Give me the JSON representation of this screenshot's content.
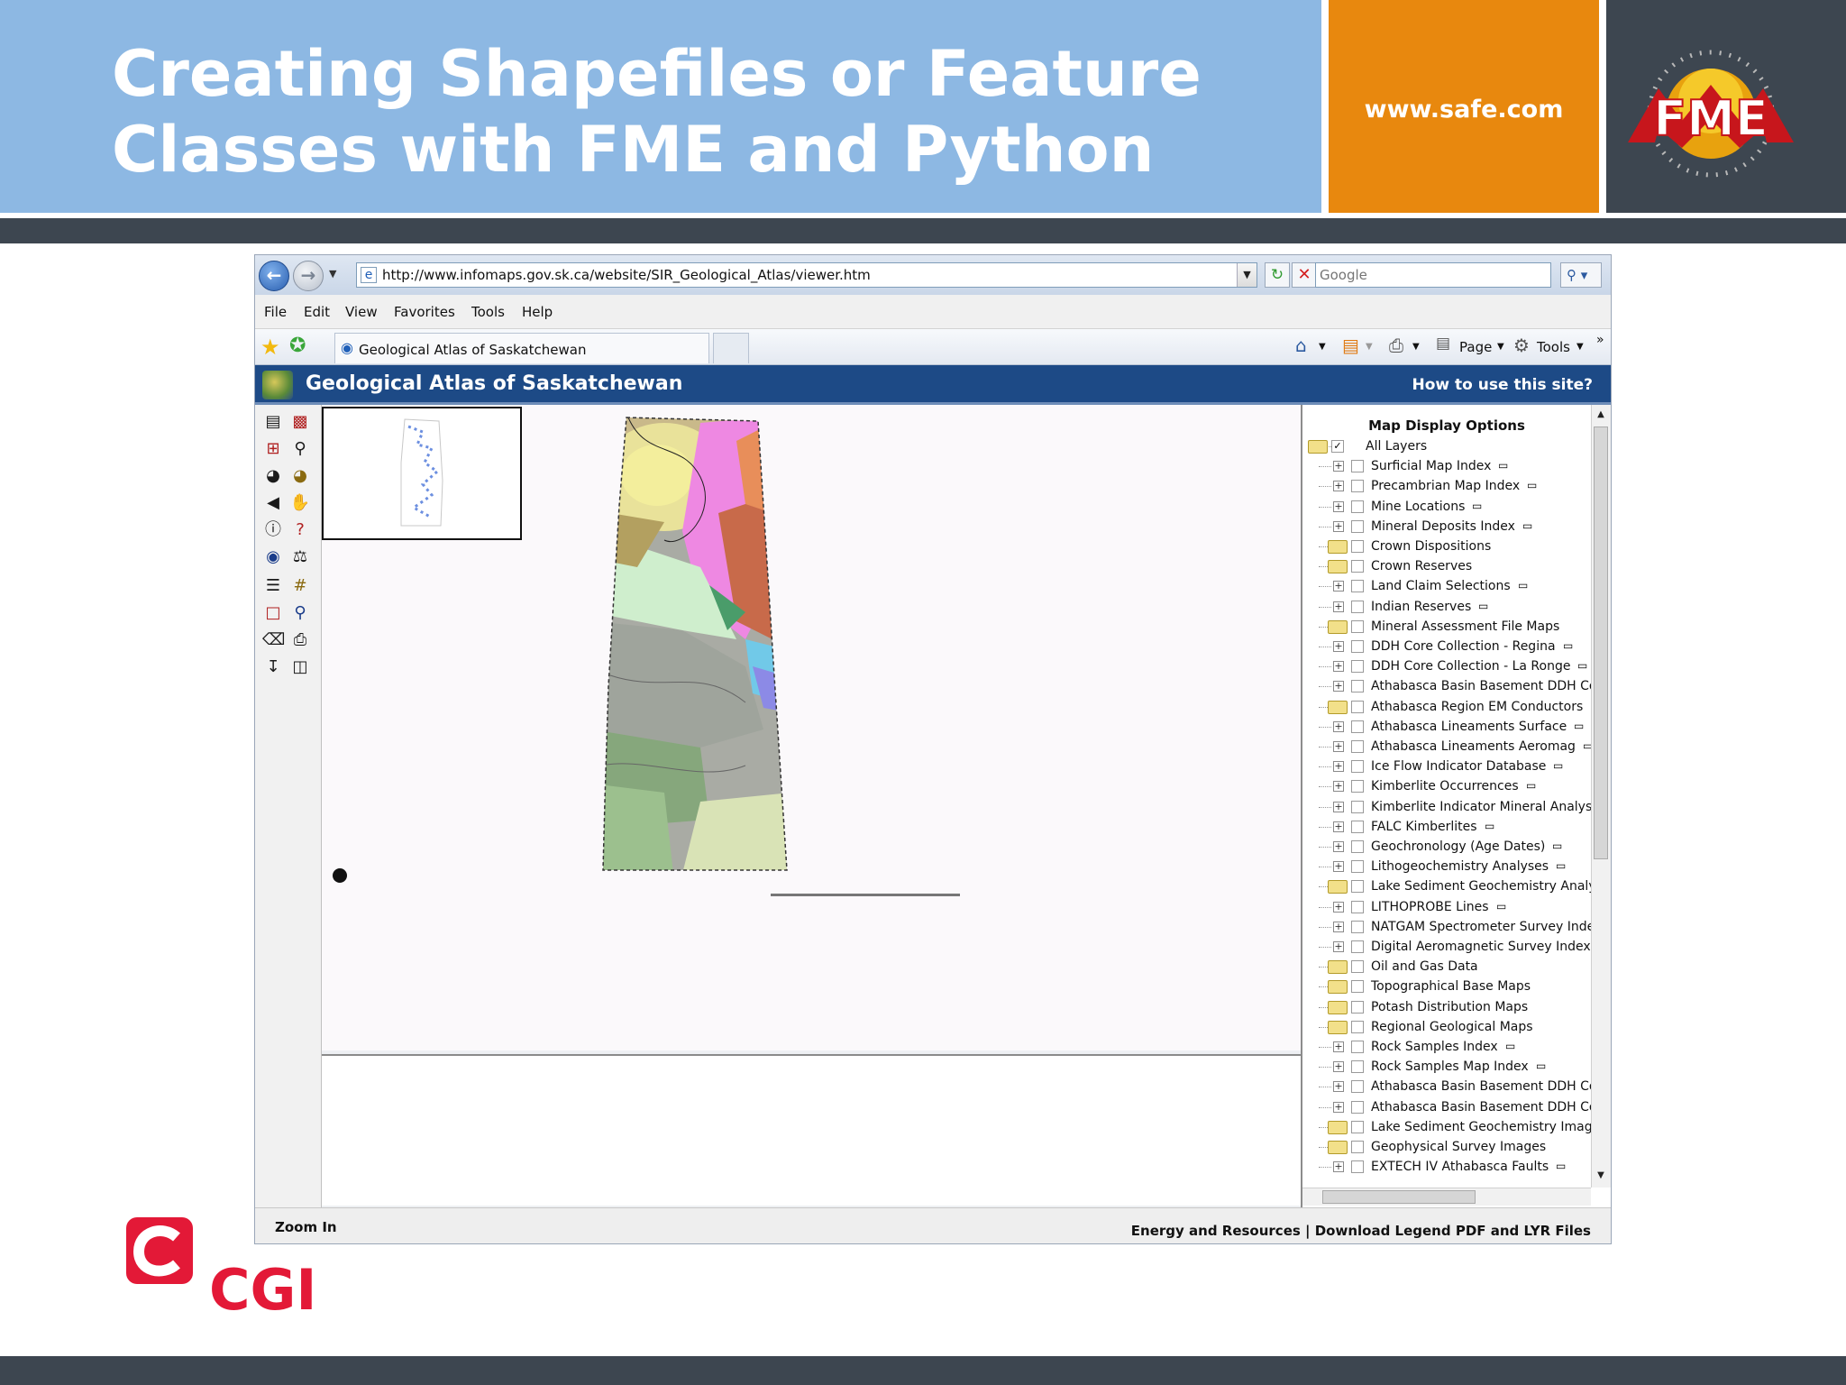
{
  "slide": {
    "title_line1": "Creating Shapefiles or Feature",
    "title_line2": "Classes with FME and Python",
    "url": "www.safe.com",
    "fme_logo": "FME",
    "cgi_logo": "CGI",
    "colors": {
      "banner_blue": "#8db8e3",
      "banner_orange": "#e8880e",
      "banner_dark": "#3d4650",
      "cgi_red": "#e31937"
    }
  },
  "browser": {
    "address": "http://www.infomaps.gov.sk.ca/website/SIR_Geological_Atlas/viewer.htm",
    "search_placeholder": "Google",
    "menu": [
      "File",
      "Edit",
      "View",
      "Favorites",
      "Tools",
      "Help"
    ],
    "tab_label": "Geological Atlas of Saskatchewan",
    "commands": {
      "page": "Page",
      "tools": "Tools"
    }
  },
  "app": {
    "title": "Geological Atlas of Saskatchewan",
    "help_link": "How to use this site?",
    "status_left": "Zoom In",
    "status_right": "Energy and Resources  |  Download Legend PDF and LYR Files"
  },
  "layers": {
    "header": "Map Display Options",
    "items": [
      {
        "label": "All Layers",
        "kind": "root",
        "checked": true
      },
      {
        "label": "Surficial Map Index",
        "kind": "layer"
      },
      {
        "label": "Precambrian Map Index",
        "kind": "layer"
      },
      {
        "label": "Mine Locations",
        "kind": "layer"
      },
      {
        "label": "Mineral Deposits Index",
        "kind": "layer"
      },
      {
        "label": "Crown Dispositions",
        "kind": "folder"
      },
      {
        "label": "Crown Reserves",
        "kind": "folder"
      },
      {
        "label": "Land Claim Selections",
        "kind": "layer"
      },
      {
        "label": "Indian Reserves",
        "kind": "layer"
      },
      {
        "label": "Mineral Assessment File Maps",
        "kind": "folder"
      },
      {
        "label": "DDH Core Collection - Regina",
        "kind": "layer"
      },
      {
        "label": "DDH Core Collection - La Ronge",
        "kind": "layer"
      },
      {
        "label": "Athabasca Basin Basement DDH Com",
        "kind": "layer"
      },
      {
        "label": "Athabasca Region EM Conductors",
        "kind": "folder"
      },
      {
        "label": "Athabasca Lineaments Surface",
        "kind": "layer"
      },
      {
        "label": "Athabasca Lineaments Aeromag",
        "kind": "layer"
      },
      {
        "label": "Ice Flow Indicator Database",
        "kind": "layer"
      },
      {
        "label": "Kimberlite Occurrences",
        "kind": "layer"
      },
      {
        "label": "Kimberlite Indicator Mineral Analyses",
        "kind": "layer"
      },
      {
        "label": "FALC Kimberlites",
        "kind": "layer"
      },
      {
        "label": "Geochronology (Age Dates)",
        "kind": "layer"
      },
      {
        "label": "Lithogeochemistry Analyses",
        "kind": "layer"
      },
      {
        "label": "Lake Sediment Geochemistry Analyse",
        "kind": "folder"
      },
      {
        "label": "LITHOPROBE Lines",
        "kind": "layer"
      },
      {
        "label": "NATGAM Spectrometer Survey Index",
        "kind": "layer"
      },
      {
        "label": "Digital Aeromagnetic Survey Index",
        "kind": "layer"
      },
      {
        "label": "Oil and Gas Data",
        "kind": "folder"
      },
      {
        "label": "Topographical Base Maps",
        "kind": "folder"
      },
      {
        "label": "Potash Distribution Maps",
        "kind": "folder"
      },
      {
        "label": "Regional Geological Maps",
        "kind": "folder"
      },
      {
        "label": "Rock Samples Index",
        "kind": "layer"
      },
      {
        "label": "Rock Samples Map Index",
        "kind": "layer"
      },
      {
        "label": "Athabasca Basin Basement DDH Com",
        "kind": "layer"
      },
      {
        "label": "Athabasca Basin Basement DDH Com",
        "kind": "layer"
      },
      {
        "label": "Lake Sediment Geochemistry Images",
        "kind": "folder"
      },
      {
        "label": "Geophysical Survey Images",
        "kind": "folder"
      },
      {
        "label": "EXTECH IV Athabasca Faults",
        "kind": "layer"
      }
    ]
  },
  "tools": [
    "legend-icon",
    "layers-icon",
    "zoom-in-box-icon",
    "zoom-in-icon",
    "zoom-out-icon",
    "full-extent-icon",
    "back-extent-icon",
    "pan-icon",
    "identify-icon",
    "hyperlink-icon",
    "find-icon",
    "measure-icon",
    "attribute-table-icon",
    "grid-icon",
    "select-box-icon",
    "query-icon",
    "clear-icon",
    "print-icon",
    "download-icon",
    "bookmark-icon"
  ]
}
